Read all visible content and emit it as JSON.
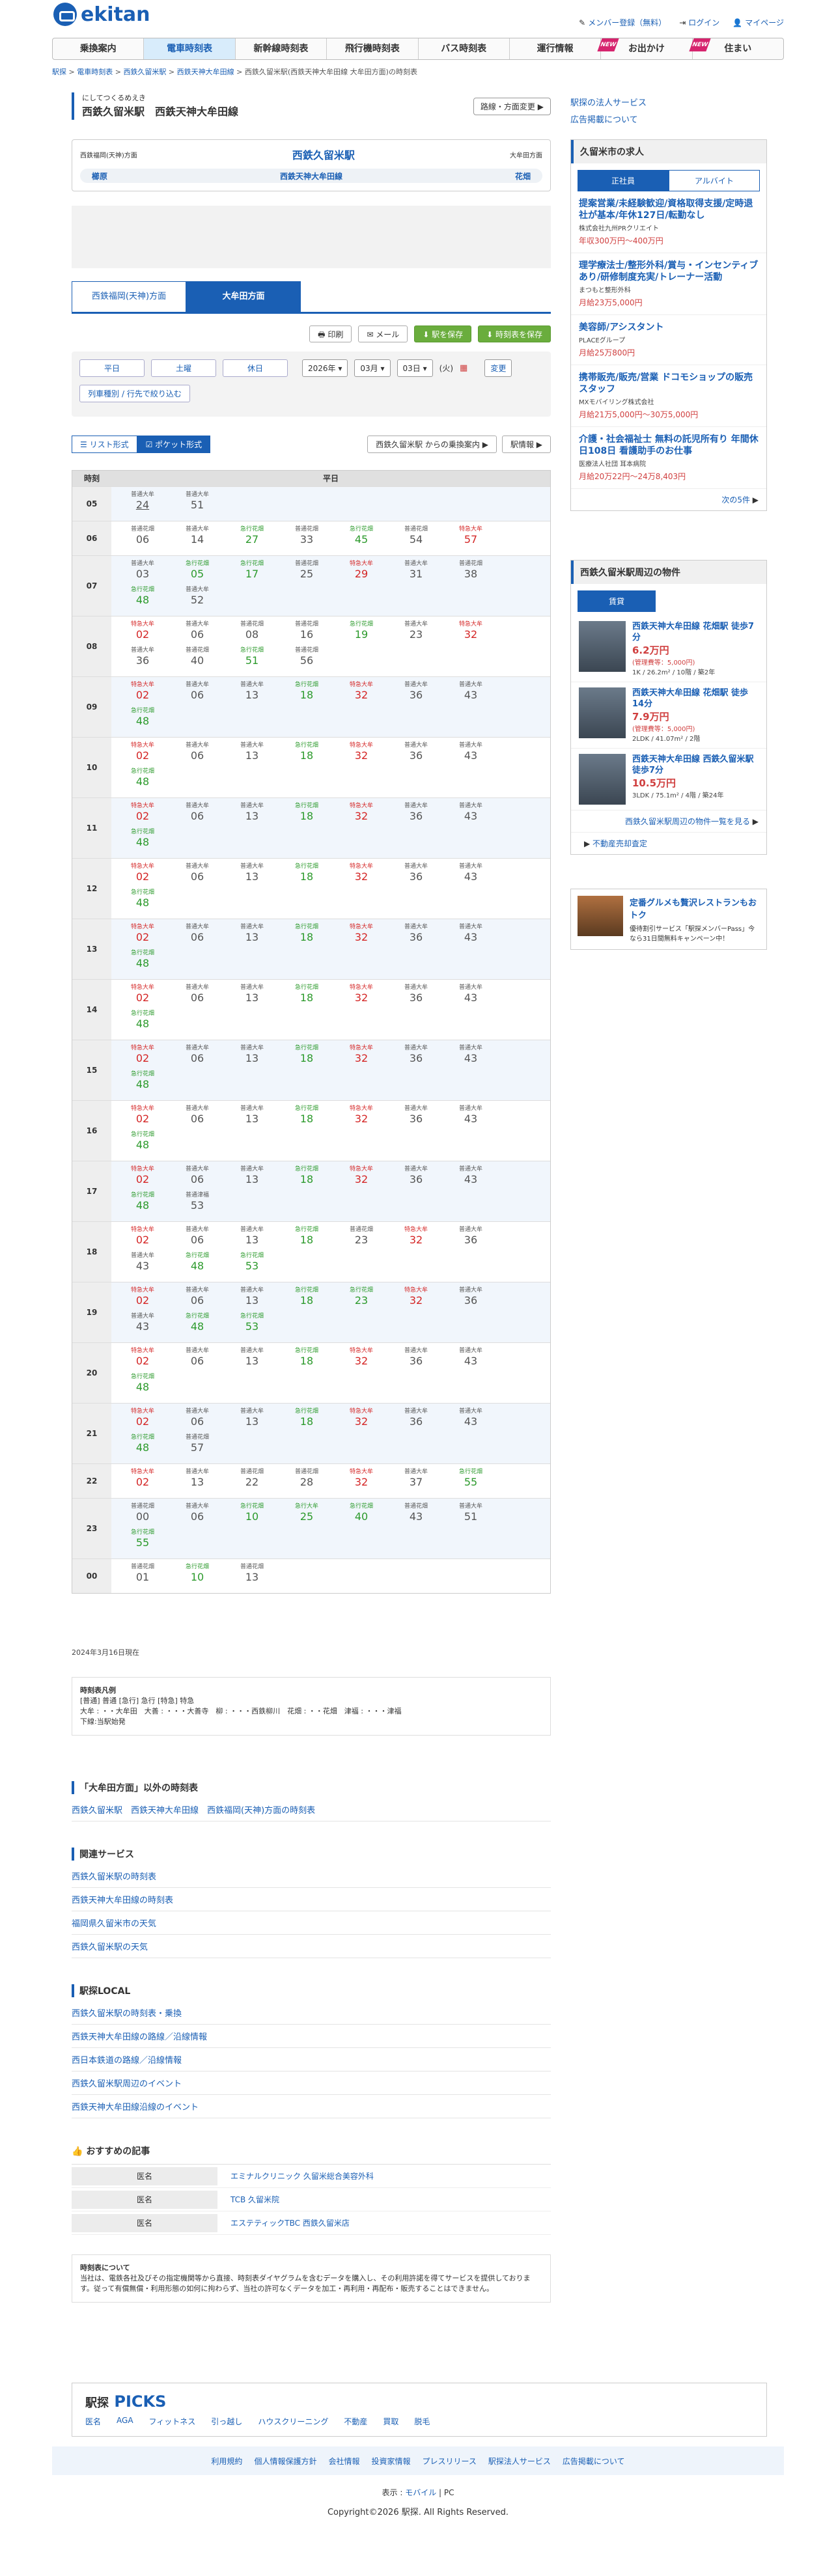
{
  "header": {
    "logo": "ekitan",
    "links": [
      "メンバー登録（無料）",
      "ログイン",
      "マイページ"
    ]
  },
  "nav": [
    {
      "label": "乗換案内",
      "new": ""
    },
    {
      "label": "電車時刻表",
      "new": ""
    },
    {
      "label": "新幹線時刻表",
      "new": ""
    },
    {
      "label": "飛行機時刻表",
      "new": ""
    },
    {
      "label": "バス時刻表",
      "new": ""
    },
    {
      "label": "運行情報",
      "new": ""
    },
    {
      "label": "お出かけ",
      "new": "NEW"
    },
    {
      "label": "住まい",
      "new": "NEW"
    }
  ],
  "breadcrumb": [
    "駅探",
    "電車時刻表",
    "西鉄久留米駅",
    "西鉄天神大牟田線",
    "西鉄久留米駅(西鉄天神大牟田線 大牟田方面)の時刻表"
  ],
  "title": {
    "small": "にしてつくるめえき",
    "big": "西鉄久留米駅　西鉄天神大牟田線",
    "dir_button": "路線・方面変更"
  },
  "station": {
    "left": "西鉄福岡(天神)方面",
    "center": "西鉄久留米駅",
    "right": "大牟田方面",
    "prev": "櫛原",
    "line": "西鉄天神大牟田線",
    "next": "花畑"
  },
  "tabs": [
    "西鉄福岡(天神)方面",
    "大牟田方面"
  ],
  "tools": [
    "印刷",
    "メール",
    "駅を保存",
    "時刻表を保存"
  ],
  "date": {
    "days": [
      "平日",
      "土曜",
      "休日"
    ],
    "year": "2026年",
    "month": "03月",
    "day": "03日",
    "dow": "(火)",
    "change": "変更",
    "filter": "列車種別 / 行先で絞り込む"
  },
  "view": {
    "list": "リスト形式",
    "pocket": "ポケット形式",
    "route": "西鉄久留米駅 からの乗換案内",
    "info": "駅情報"
  },
  "table": {
    "h": "時刻",
    "d": "平日"
  },
  "hours": [
    {
      "h": "05",
      "t": [
        [
          "普通大牟",
          "24",
          0
        ],
        [
          "普通大牟",
          "51",
          0
        ]
      ]
    },
    {
      "h": "06",
      "t": [
        [
          "普通花畑",
          "06",
          0
        ],
        [
          "普通大牟",
          "14",
          0
        ],
        [
          "急行花畑",
          "27",
          1
        ],
        [
          "普通花畑",
          "33",
          0
        ],
        [
          "急行花畑",
          "45",
          1
        ],
        [
          "普通花畑",
          "54",
          0
        ],
        [
          "特急大牟",
          "57",
          2
        ]
      ]
    },
    {
      "h": "07",
      "t": [
        [
          "普通大牟",
          "03",
          0
        ],
        [
          "急行花畑",
          "05",
          1
        ],
        [
          "急行花畑",
          "17",
          1
        ],
        [
          "普通花畑",
          "25",
          0
        ],
        [
          "特急大牟",
          "29",
          2
        ],
        [
          "普通大牟",
          "31",
          0
        ],
        [
          "普通花畑",
          "38",
          0
        ],
        [
          "急行花畑",
          "48",
          1
        ],
        [
          "普通大牟",
          "52",
          0
        ]
      ]
    },
    {
      "h": "08",
      "t": [
        [
          "特急大牟",
          "02",
          2
        ],
        [
          "普通大牟",
          "06",
          0
        ],
        [
          "普通花畑",
          "08",
          0
        ],
        [
          "普通花畑",
          "16",
          0
        ],
        [
          "急行花畑",
          "19",
          1
        ],
        [
          "普通大牟",
          "23",
          0
        ],
        [
          "特急大牟",
          "32",
          2
        ],
        [
          "普通大牟",
          "36",
          0
        ],
        [
          "普通花畑",
          "40",
          0
        ],
        [
          "急行花畑",
          "51",
          1
        ],
        [
          "普通花畑",
          "56",
          0
        ]
      ]
    },
    {
      "h": "09",
      "t": [
        [
          "特急大牟",
          "02",
          2
        ],
        [
          "普通大牟",
          "06",
          0
        ],
        [
          "普通大牟",
          "13",
          0
        ],
        [
          "急行花畑",
          "18",
          1
        ],
        [
          "特急大牟",
          "32",
          2
        ],
        [
          "普通大牟",
          "36",
          0
        ],
        [
          "普通大牟",
          "43",
          0
        ],
        [
          "急行花畑",
          "48",
          1
        ]
      ]
    },
    {
      "h": "10",
      "t": [
        [
          "特急大牟",
          "02",
          2
        ],
        [
          "普通大牟",
          "06",
          0
        ],
        [
          "普通大牟",
          "13",
          0
        ],
        [
          "急行花畑",
          "18",
          1
        ],
        [
          "特急大牟",
          "32",
          2
        ],
        [
          "普通大牟",
          "36",
          0
        ],
        [
          "普通大牟",
          "43",
          0
        ],
        [
          "急行花畑",
          "48",
          1
        ]
      ]
    },
    {
      "h": "11",
      "t": [
        [
          "特急大牟",
          "02",
          2
        ],
        [
          "普通大牟",
          "06",
          0
        ],
        [
          "普通大牟",
          "13",
          0
        ],
        [
          "急行花畑",
          "18",
          1
        ],
        [
          "特急大牟",
          "32",
          2
        ],
        [
          "普通大牟",
          "36",
          0
        ],
        [
          "普通大牟",
          "43",
          0
        ],
        [
          "急行花畑",
          "48",
          1
        ]
      ]
    },
    {
      "h": "12",
      "t": [
        [
          "特急大牟",
          "02",
          2
        ],
        [
          "普通大牟",
          "06",
          0
        ],
        [
          "普通大牟",
          "13",
          0
        ],
        [
          "急行花畑",
          "18",
          1
        ],
        [
          "特急大牟",
          "32",
          2
        ],
        [
          "普通大牟",
          "36",
          0
        ],
        [
          "普通大牟",
          "43",
          0
        ],
        [
          "急行花畑",
          "48",
          1
        ]
      ]
    },
    {
      "h": "13",
      "t": [
        [
          "特急大牟",
          "02",
          2
        ],
        [
          "普通大牟",
          "06",
          0
        ],
        [
          "普通大牟",
          "13",
          0
        ],
        [
          "急行花畑",
          "18",
          1
        ],
        [
          "特急大牟",
          "32",
          2
        ],
        [
          "普通大牟",
          "36",
          0
        ],
        [
          "普通大牟",
          "43",
          0
        ],
        [
          "急行花畑",
          "48",
          1
        ]
      ]
    },
    {
      "h": "14",
      "t": [
        [
          "特急大牟",
          "02",
          2
        ],
        [
          "普通大牟",
          "06",
          0
        ],
        [
          "普通大牟",
          "13",
          0
        ],
        [
          "急行花畑",
          "18",
          1
        ],
        [
          "特急大牟",
          "32",
          2
        ],
        [
          "普通大牟",
          "36",
          0
        ],
        [
          "普通大牟",
          "43",
          0
        ],
        [
          "急行花畑",
          "48",
          1
        ]
      ]
    },
    {
      "h": "15",
      "t": [
        [
          "特急大牟",
          "02",
          2
        ],
        [
          "普通大牟",
          "06",
          0
        ],
        [
          "普通大牟",
          "13",
          0
        ],
        [
          "急行花畑",
          "18",
          1
        ],
        [
          "特急大牟",
          "32",
          2
        ],
        [
          "普通大牟",
          "36",
          0
        ],
        [
          "普通大牟",
          "43",
          0
        ],
        [
          "急行花畑",
          "48",
          1
        ]
      ]
    },
    {
      "h": "16",
      "t": [
        [
          "特急大牟",
          "02",
          2
        ],
        [
          "普通大牟",
          "06",
          0
        ],
        [
          "普通大牟",
          "13",
          0
        ],
        [
          "急行花畑",
          "18",
          1
        ],
        [
          "特急大牟",
          "32",
          2
        ],
        [
          "普通大牟",
          "36",
          0
        ],
        [
          "普通大牟",
          "43",
          0
        ],
        [
          "急行花畑",
          "48",
          1
        ]
      ]
    },
    {
      "h": "17",
      "t": [
        [
          "特急大牟",
          "02",
          2
        ],
        [
          "普通大牟",
          "06",
          0
        ],
        [
          "普通大牟",
          "13",
          0
        ],
        [
          "急行花畑",
          "18",
          1
        ],
        [
          "特急大牟",
          "32",
          2
        ],
        [
          "普通大牟",
          "36",
          0
        ],
        [
          "普通大牟",
          "43",
          0
        ],
        [
          "急行花畑",
          "48",
          1
        ],
        [
          "普通津福",
          "53",
          0
        ]
      ]
    },
    {
      "h": "18",
      "t": [
        [
          "特急大牟",
          "02",
          2
        ],
        [
          "普通大牟",
          "06",
          0
        ],
        [
          "普通大牟",
          "13",
          0
        ],
        [
          "急行花畑",
          "18",
          1
        ],
        [
          "普通花畑",
          "23",
          0
        ],
        [
          "特急大牟",
          "32",
          2
        ],
        [
          "普通大牟",
          "36",
          0
        ],
        [
          "普通大牟",
          "43",
          0
        ],
        [
          "急行花畑",
          "48",
          1
        ],
        [
          "急行花畑",
          "53",
          1
        ]
      ]
    },
    {
      "h": "19",
      "t": [
        [
          "特急大牟",
          "02",
          2
        ],
        [
          "普通大牟",
          "06",
          0
        ],
        [
          "普通大牟",
          "13",
          0
        ],
        [
          "急行花畑",
          "18",
          1
        ],
        [
          "急行花畑",
          "23",
          1
        ],
        [
          "特急大牟",
          "32",
          2
        ],
        [
          "普通大牟",
          "36",
          0
        ],
        [
          "普通大牟",
          "43",
          0
        ],
        [
          "急行花畑",
          "48",
          1
        ],
        [
          "急行花畑",
          "53",
          1
        ]
      ]
    },
    {
      "h": "20",
      "t": [
        [
          "特急大牟",
          "02",
          2
        ],
        [
          "普通大牟",
          "06",
          0
        ],
        [
          "普通大牟",
          "13",
          0
        ],
        [
          "急行花畑",
          "18",
          1
        ],
        [
          "特急大牟",
          "32",
          2
        ],
        [
          "普通大牟",
          "36",
          0
        ],
        [
          "普通大牟",
          "43",
          0
        ],
        [
          "急行花畑",
          "48",
          1
        ]
      ]
    },
    {
      "h": "21",
      "t": [
        [
          "特急大牟",
          "02",
          2
        ],
        [
          "普通大牟",
          "06",
          0
        ],
        [
          "普通大牟",
          "13",
          0
        ],
        [
          "急行花畑",
          "18",
          1
        ],
        [
          "特急大牟",
          "32",
          2
        ],
        [
          "普通大牟",
          "36",
          0
        ],
        [
          "普通大牟",
          "43",
          0
        ],
        [
          "急行花畑",
          "48",
          1
        ],
        [
          "普通花畑",
          "57",
          0
        ]
      ]
    },
    {
      "h": "22",
      "t": [
        [
          "特急大牟",
          "02",
          2
        ],
        [
          "普通大牟",
          "13",
          0
        ],
        [
          "普通花畑",
          "22",
          0
        ],
        [
          "普通花畑",
          "28",
          0
        ],
        [
          "特急大牟",
          "32",
          2
        ],
        [
          "普通大牟",
          "37",
          0
        ],
        [
          "急行花畑",
          "55",
          1
        ]
      ]
    },
    {
      "h": "23",
      "t": [
        [
          "普通花畑",
          "00",
          0
        ],
        [
          "普通大牟",
          "06",
          0
        ],
        [
          "急行花畑",
          "10",
          1
        ],
        [
          "急行大牟",
          "25",
          1
        ],
        [
          "急行花畑",
          "40",
          1
        ],
        [
          "普通花畑",
          "43",
          0
        ],
        [
          "普通大牟",
          "51",
          0
        ],
        [
          "急行花畑",
          "55",
          1
        ]
      ]
    },
    {
      "h": "00",
      "t": [
        [
          "普通花畑",
          "01",
          0
        ],
        [
          "急行花畑",
          "10",
          1
        ],
        [
          "普通花畑",
          "13",
          0
        ]
      ]
    }
  ],
  "updated": "2024年3月16日現在",
  "legend": {
    "title": "時刻表凡例",
    "l1": "[普通] 普通 [急行] 急行 [特急] 特急",
    "l2": "大牟 : ・・大牟田　大善 : ・・・大善寺　柳 : ・・・西鉄柳川　花畑 : ・・花畑　津福 : ・・・津福",
    "l3": "下線:当駅始発"
  },
  "other": {
    "title": "「大牟田方面」以外の時刻表",
    "links": [
      "西鉄久留米駅　西鉄天神大牟田線　西鉄福岡(天神)方面の時刻表"
    ]
  },
  "related": {
    "title": "関連サービス",
    "links": [
      "西鉄久留米駅の時刻表",
      "西鉄天神大牟田線の時刻表",
      "福岡県久留米市の天気",
      "西鉄久留米駅の天気"
    ]
  },
  "local": {
    "title": "駅探LOCAL",
    "links": [
      "西鉄久留米駅の時刻表・乗換",
      "西鉄天神大牟田線の路線／沿線情報",
      "西日本鉄道の路線／沿線情報",
      "西鉄久留米駅周辺のイベント",
      "西鉄天神大牟田線沿線のイベント"
    ]
  },
  "recommend": {
    "title": "おすすめの記事",
    "rows": [
      [
        "医名",
        "エミナルクリニック 久留米総合美容外科"
      ],
      [
        "医名",
        "TCB 久留米院"
      ],
      [
        "医名",
        "エステティックTBC 西鉄久留米店"
      ]
    ]
  },
  "about": {
    "title": "時刻表について",
    "text": "当社は、電鉄各社及びその指定機関等から直接、時刻表ダイヤグラムを含むデータを購入し、その利用許諾を得てサービスを提供しております。従って有償無償・利用形態の如何に拘わらず、当社の許可なくデータを加工・再利用・再配布・販売することはできません。"
  },
  "picks": {
    "brand": "駅探",
    "sub": "PICKS",
    "links": [
      "医名",
      "AGA",
      "フィットネス",
      "引っ越し",
      "ハウスクリーニング",
      "不動産",
      "買取",
      "脱毛"
    ]
  },
  "footer": {
    "links": [
      "利用規約",
      "個人情報保護方針",
      "会社情報",
      "投資家情報",
      "プレスリリース",
      "駅探法人サービス",
      "広告掲載について"
    ],
    "display": "表示 :",
    "mobile": "モバイル",
    "pc": "PC",
    "copy": "Copyright©2026 駅探. All Rights Reserved."
  },
  "side": {
    "links": [
      "駅探の法人サービス",
      "広告掲載について"
    ],
    "jobs_title": "久留米市の求人",
    "job_tabs": [
      "正社員",
      "アルバイト"
    ],
    "jobs": [
      {
        "t": "提案営業/未経験歓迎/資格取得支援/定時退社が基本/年休127日/転勤なし",
        "c": "株式会社九州PRクリエイト",
        "p": "年収300万円〜400万円"
      },
      {
        "t": "理学療法士/整形外科/賞与・インセンティブあり/研修制度充実/トレーナー活動",
        "c": "まつもと整形外科",
        "p": "月給23万5,000円"
      },
      {
        "t": "美容師/アシスタント",
        "c": "PLACEグループ",
        "p": "月給25万800円"
      },
      {
        "t": "携帯販売/販売/営業 ドコモショップの販売スタッフ",
        "c": "MXモバイリング株式会社",
        "p": "月給21万5,000円〜30万5,000円"
      },
      {
        "t": "介護・社会福祉士 無料の託児所有り 年間休日108日 看護助手のお仕事",
        "c": "医療法人社団 耳本病院",
        "p": "月給20万22円〜24万8,403円"
      }
    ],
    "jobs_more": "次の5件",
    "prop_title": "西鉄久留米駅周辺の物件",
    "prop_tab": "賃貸",
    "props": [
      {
        "t": "西鉄天神大牟田線 花畑駅 徒歩7分",
        "p": "6.2万円",
        "m": "(管理費等：5,000円)",
        "c": "1K / 26.2m² / 10階 / 築2年"
      },
      {
        "t": "西鉄天神大牟田線 花畑駅 徒歩14分",
        "p": "7.9万円",
        "m": "(管理費等：5,000円)",
        "c": "2LDK / 41.07m² / 2階"
      },
      {
        "t": "西鉄天神大牟田線 西鉄久留米駅 徒歩7分",
        "p": "10.5万円",
        "m": "",
        "c": "3LDK / 75.1m² / 4階 / 築24年"
      }
    ],
    "prop_more": "西鉄久留米駅周辺の物件一覧を見る",
    "realestate": "不動産売却査定",
    "ad": "定番グルメも贅沢レストランもおトク",
    "ad_sub": "優待割引サービス「駅探メンバーPass」今なら31日間無料キャンペーン中！"
  }
}
